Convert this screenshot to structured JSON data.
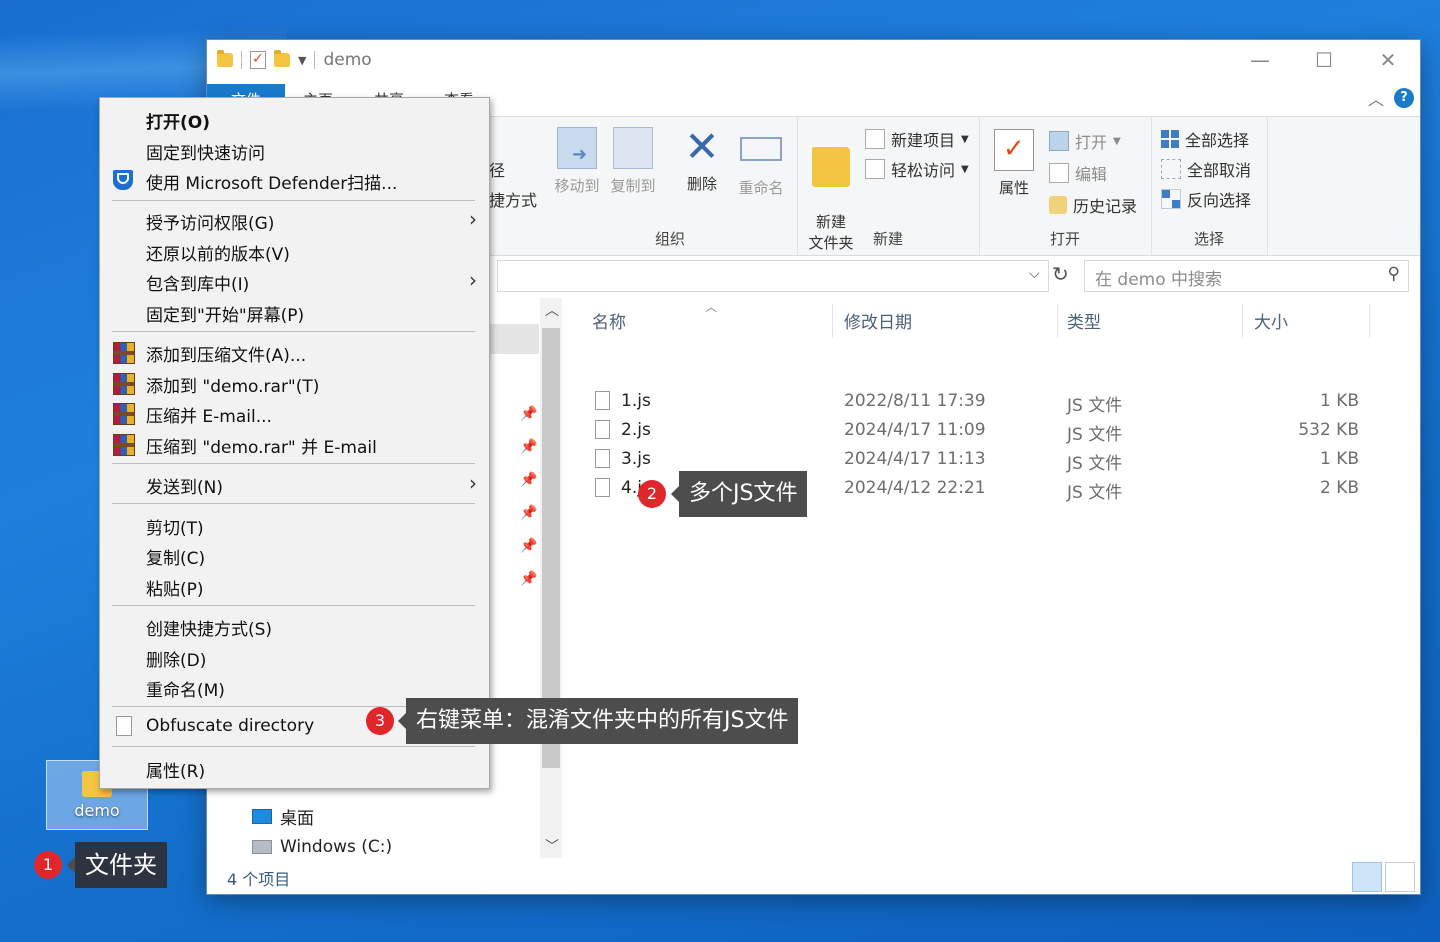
{
  "window": {
    "title": "demo",
    "tabs": [
      "文件",
      "主页",
      "共享",
      "查看"
    ]
  },
  "ribbon": {
    "partial_labels": [
      "径",
      "捷方式"
    ],
    "organize": {
      "label": "组织",
      "move_to": "移动到",
      "copy_to": "复制到",
      "delete": "删除",
      "rename": "重命名"
    },
    "new": {
      "label": "新建",
      "new_folder": "新建\n文件夹",
      "new_item": "新建项目",
      "easy_access": "轻松访问"
    },
    "open": {
      "label": "打开",
      "properties": "属性",
      "open": "打开",
      "edit": "编辑",
      "history": "历史记录"
    },
    "select": {
      "label": "选择",
      "select_all": "全部选择",
      "select_none": "全部取消",
      "invert": "反向选择"
    }
  },
  "search": {
    "placeholder": "在 demo 中搜索"
  },
  "columns": {
    "name": "名称",
    "date": "修改日期",
    "type": "类型",
    "size": "大小"
  },
  "files": [
    {
      "name": "1.js",
      "date": "2022/8/11 17:39",
      "type": "JS 文件",
      "size": "1 KB"
    },
    {
      "name": "2.js",
      "date": "2024/4/17 11:09",
      "type": "JS 文件",
      "size": "532 KB"
    },
    {
      "name": "3.js",
      "date": "2024/4/17 11:13",
      "type": "JS 文件",
      "size": "1 KB"
    },
    {
      "name": "4.js",
      "date": "2024/4/12 22:21",
      "type": "JS 文件",
      "size": "2 KB"
    }
  ],
  "nav": {
    "desktop": "桌面",
    "drive": "Windows (C:)"
  },
  "status": {
    "item_count": "4 个项目"
  },
  "desktop_folder": {
    "name": "demo"
  },
  "context_menu": {
    "items": [
      "打开(O)",
      "固定到快速访问",
      "使用 Microsoft Defender扫描...",
      "授予访问权限(G)",
      "还原以前的版本(V)",
      "包含到库中(I)",
      "固定到\"开始\"屏幕(P)",
      "添加到压缩文件(A)...",
      "添加到 \"demo.rar\"(T)",
      "压缩并 E-mail...",
      "压缩到 \"demo.rar\" 并 E-mail",
      "发送到(N)",
      "剪切(T)",
      "复制(C)",
      "粘贴(P)",
      "创建快捷方式(S)",
      "删除(D)",
      "重命名(M)",
      "Obfuscate directory",
      "属性(R)"
    ]
  },
  "annotations": {
    "badge1": "1",
    "callout1": "文件夹",
    "badge2": "2",
    "callout2": "多个JS文件",
    "badge3": "3",
    "callout3": "右键菜单：混淆文件夹中的所有JS文件"
  },
  "colors": {
    "accent": "#1979ca",
    "badge": "#e0262b",
    "callout_bg": "#4d4d4d"
  }
}
